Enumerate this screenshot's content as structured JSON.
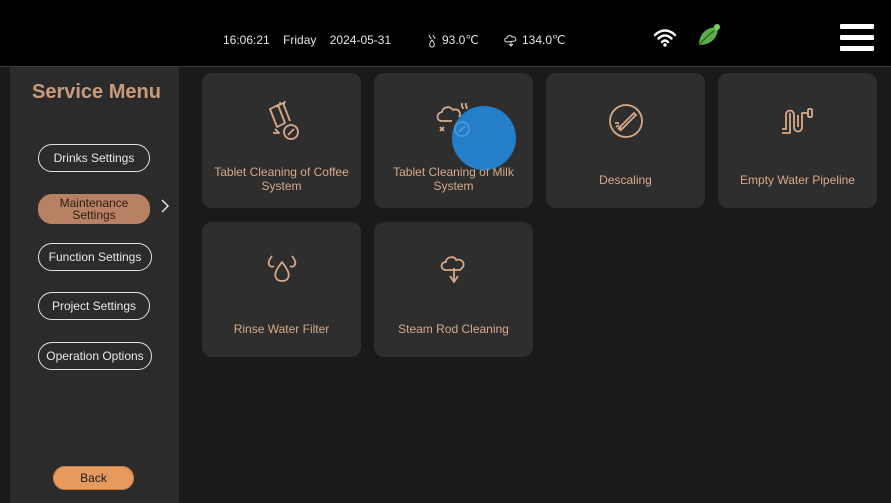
{
  "status": {
    "time": "16:06:21",
    "day": "Friday",
    "date": "2024-05-31",
    "temp1": "93.0℃",
    "temp2": "134.0℃"
  },
  "sidebar": {
    "title": "Service Menu",
    "items": [
      {
        "label": "Drinks Settings"
      },
      {
        "label": "Maintenance Settings"
      },
      {
        "label": "Function Settings"
      },
      {
        "label": "Project Settings"
      },
      {
        "label": "Operation Options"
      }
    ],
    "back_label": "Back"
  },
  "tiles": [
    {
      "label": "Tablet Cleaning of Coffee System",
      "icon": "tablet-cleaning-coffee-icon"
    },
    {
      "label": "Tablet Cleaning of Milk System",
      "icon": "tablet-cleaning-milk-icon"
    },
    {
      "label": "Descaling",
      "icon": "descaling-icon"
    },
    {
      "label": "Empty Water Pipeline",
      "icon": "pipeline-icon"
    },
    {
      "label": "Rinse Water Filter",
      "icon": "water-drops-icon"
    },
    {
      "label": "Steam Rod Cleaning",
      "icon": "steam-rod-icon"
    }
  ],
  "colors": {
    "accent": "#c99a7c",
    "active": "#b98163",
    "back": "#e69a5e",
    "touch": "#2196f3"
  }
}
